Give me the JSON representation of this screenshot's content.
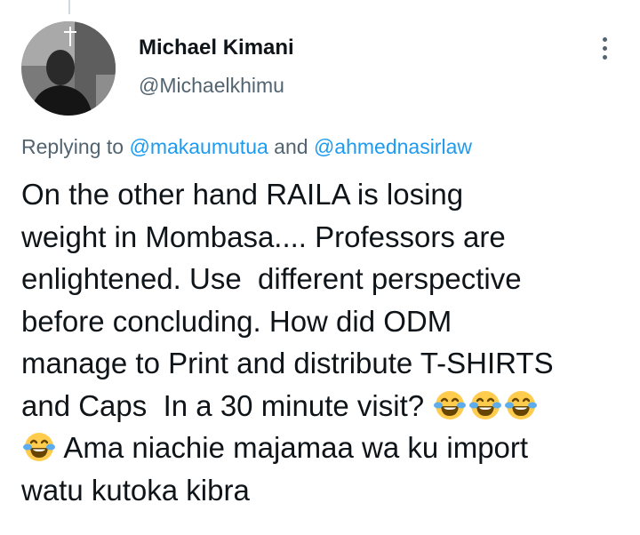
{
  "tweet": {
    "author": {
      "display_name": "Michael Kimani",
      "handle": "@Michaelkhimu"
    },
    "more_icon": "more-vertical-icon",
    "replying": {
      "prefix": "Replying to",
      "mention_1": "@makaumutua",
      "conjunction": "and",
      "mention_2": "@ahmednasirlaw"
    },
    "lines": [
      "On the other hand RAILA is losing",
      "weight in Mombasa.... Professors are",
      "enlightened. Use  different perspective",
      "before concluding. How did ODM",
      "manage to Print and distribute T-SHIRTS",
      "and Caps  In a 30 minute visit? ",
      " Ama niachie majamaa wa ku import",
      "watu kutoka kibra"
    ],
    "emoji": "face-with-tears-of-joy-icon",
    "colors": {
      "text": "#0f1419",
      "secondary": "#536471",
      "link": "#1d9bf0"
    }
  }
}
